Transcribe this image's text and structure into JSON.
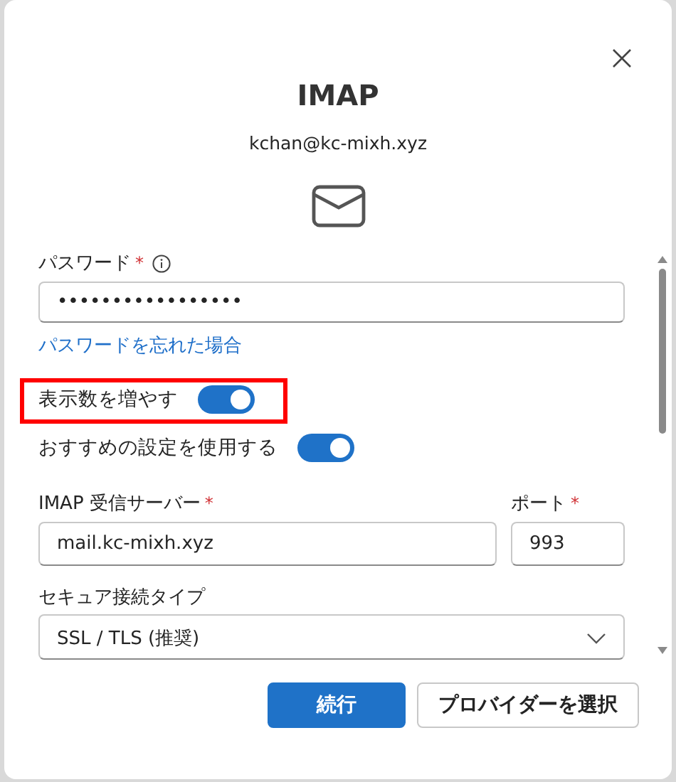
{
  "dialog": {
    "title": "IMAP",
    "account": "kchan@kc-mixh.xyz"
  },
  "password": {
    "label": "パスワード",
    "required_mark": "*",
    "value": "•••••••••••••••••",
    "forgot_link": "パスワードを忘れた場合"
  },
  "toggles": [
    {
      "label": "表示数を増やす",
      "on": true,
      "highlighted": true
    },
    {
      "label": "おすすめの設定を使用する",
      "on": true,
      "highlighted": false
    }
  ],
  "server": {
    "label": "IMAP 受信サーバー",
    "required_mark": "*",
    "value": "mail.kc-mixh.xyz"
  },
  "port": {
    "label": "ポート",
    "required_mark": "*",
    "value": "993"
  },
  "security": {
    "label": "セキュア接続タイプ",
    "value": "SSL / TLS (推奨)"
  },
  "buttons": [
    {
      "label": "続行",
      "kind": "primary"
    },
    {
      "label": "プロバイダーを選択",
      "kind": "secondary"
    }
  ]
}
